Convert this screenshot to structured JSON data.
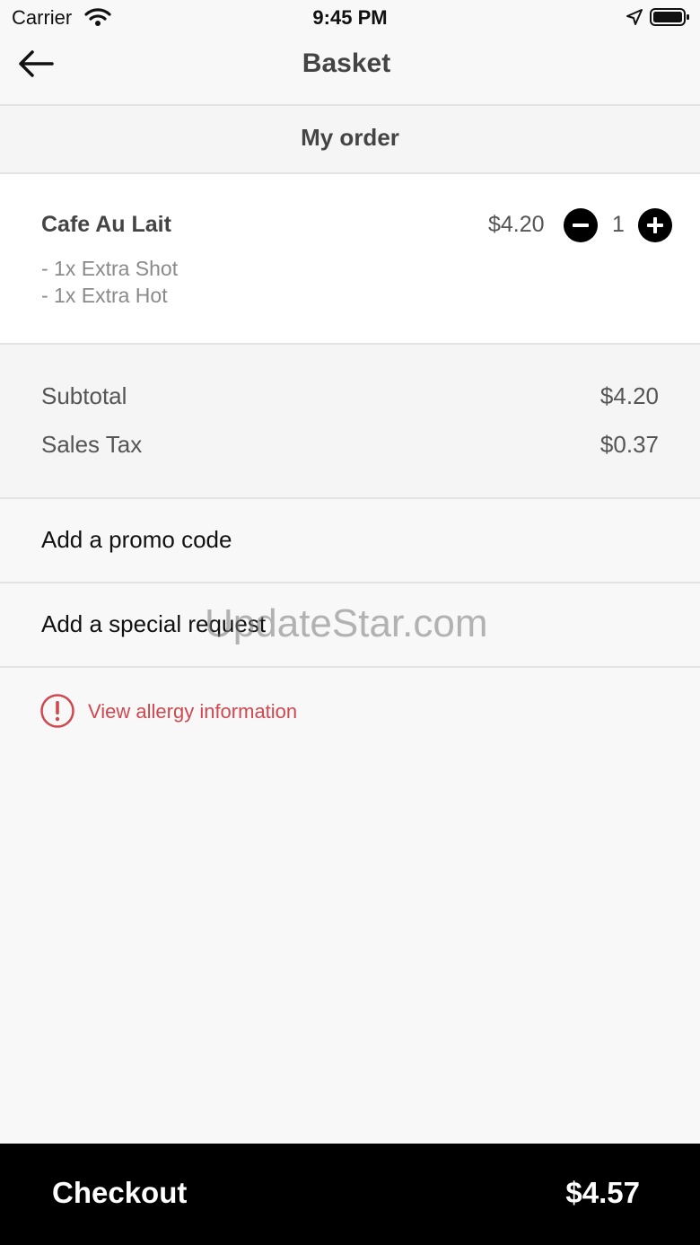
{
  "status_bar": {
    "carrier": "Carrier",
    "time": "9:45 PM",
    "icons": [
      "wifi-icon",
      "location-arrow-icon",
      "battery-icon"
    ]
  },
  "nav": {
    "back_icon": "back-arrow-icon",
    "title": "Basket"
  },
  "section": {
    "title": "My order"
  },
  "order_items": [
    {
      "name": "Cafe Au Lait",
      "price": "$4.20",
      "quantity": "1",
      "modifiers": [
        "- 1x Extra Shot",
        "- 1x Extra Hot"
      ]
    }
  ],
  "totals": {
    "subtotal_label": "Subtotal",
    "subtotal_value": "$4.20",
    "tax_label": "Sales Tax",
    "tax_value": "$0.37"
  },
  "actions": {
    "promo_label": "Add a promo code",
    "request_label": "Add a special request"
  },
  "watermark": "UpdateStar.com",
  "allergy": {
    "icon": "alert-circle-icon",
    "label": "View allergy information"
  },
  "checkout": {
    "label": "Checkout",
    "total": "$4.57"
  },
  "colors": {
    "accent_red": "#d0484f",
    "checkout_bg": "#000000",
    "background": "#f8f8f8"
  }
}
